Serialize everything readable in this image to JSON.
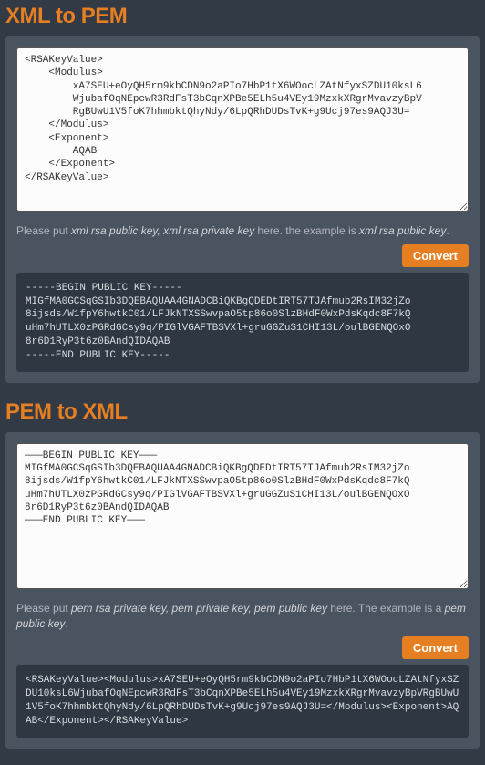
{
  "section1": {
    "title": "XML to PEM",
    "textarea_value": "<RSAKeyValue>\n    <Modulus>\n        xA7SEU+eOyQH5rm9kbCDN9o2aPIo7HbP1tX6WOocLZAtNfyxSZDU10ksL6\n        WjubafOqNEpcwR3RdFsT3bCqnXPBe5ELh5u4VEy19MzxkXRgrMvavzyBpV\n        RgBUwU1V5foK7hhmbktQhyNdy/6LpQRhDUDsTvK+g9Ucj97es9AQJ3U=\n    </Modulus>\n    <Exponent>\n        AQAB\n    </Exponent>\n</RSAKeyValue>",
    "hint_prefix": "Please put ",
    "hint_keys": "xml rsa public key, xml rsa private key",
    "hint_mid": " here. the example is ",
    "hint_end_key": "xml rsa public key",
    "hint_period": ".",
    "button": "Convert",
    "output": "-----BEGIN PUBLIC KEY-----\nMIGfMA0GCSqGSIb3DQEBAQUAA4GNADCBiQKBgQDEDtIRT57TJAfmub2RsIM32jZo\n8ijsds/W1fpY6hwtkC01/LFJkNTXSSwvpaO5tp86o0SlzBHdF0WxPdsKqdc8F7kQ\nuHm7hUTLX0zPGRdGCsy9q/PIGlVGAFTBSVXl+gruGGZuS1CHI13L/oulBGENQOxO\n8r6D1RyP3t6z0BAndQIDAQAB\n-----END PUBLIC KEY-----"
  },
  "section2": {
    "title": "PEM to XML",
    "textarea_value": "———BEGIN PUBLIC KEY———\nMIGfMA0GCSqGSIb3DQEBAQUAA4GNADCBiQKBgQDEDtIRT57TJAfmub2RsIM32jZo\n8ijsds/W1fpY6hwtkC01/LFJkNTXSSwvpaO5tp86o0SlzBHdF0WxPdsKqdc8F7kQ\nuHm7hUTLX0zPGRdGCsy9q/PIGlVGAFTBSVXl+gruGGZuS1CHI13L/oulBGENQOxO\n8r6D1RyP3t6z0BAndQIDAQAB\n———END PUBLIC KEY———",
    "hint_prefix": "Please put ",
    "hint_keys": "pem rsa private key, pem private key, pem public key",
    "hint_mid": " here. The example is a ",
    "hint_end_key": "pem public key",
    "hint_period": ".",
    "button": "Convert",
    "output": "<RSAKeyValue><Modulus>xA7SEU+eOyQH5rm9kbCDN9o2aPIo7HbP1tX6WOocLZAtNfyxSZDU10ksL6WjubafOqNEpcwR3RdFsT3bCqnXPBe5ELh5u4VEy19MzxkXRgrMvavzyBpVRgBUwU1V5foK7hhmbktQhyNdy/6LpQRhDUDsTvK+g9Ucj97es9AQJ3U=</Modulus><Exponent>AQAB</Exponent></RSAKeyValue>"
  }
}
